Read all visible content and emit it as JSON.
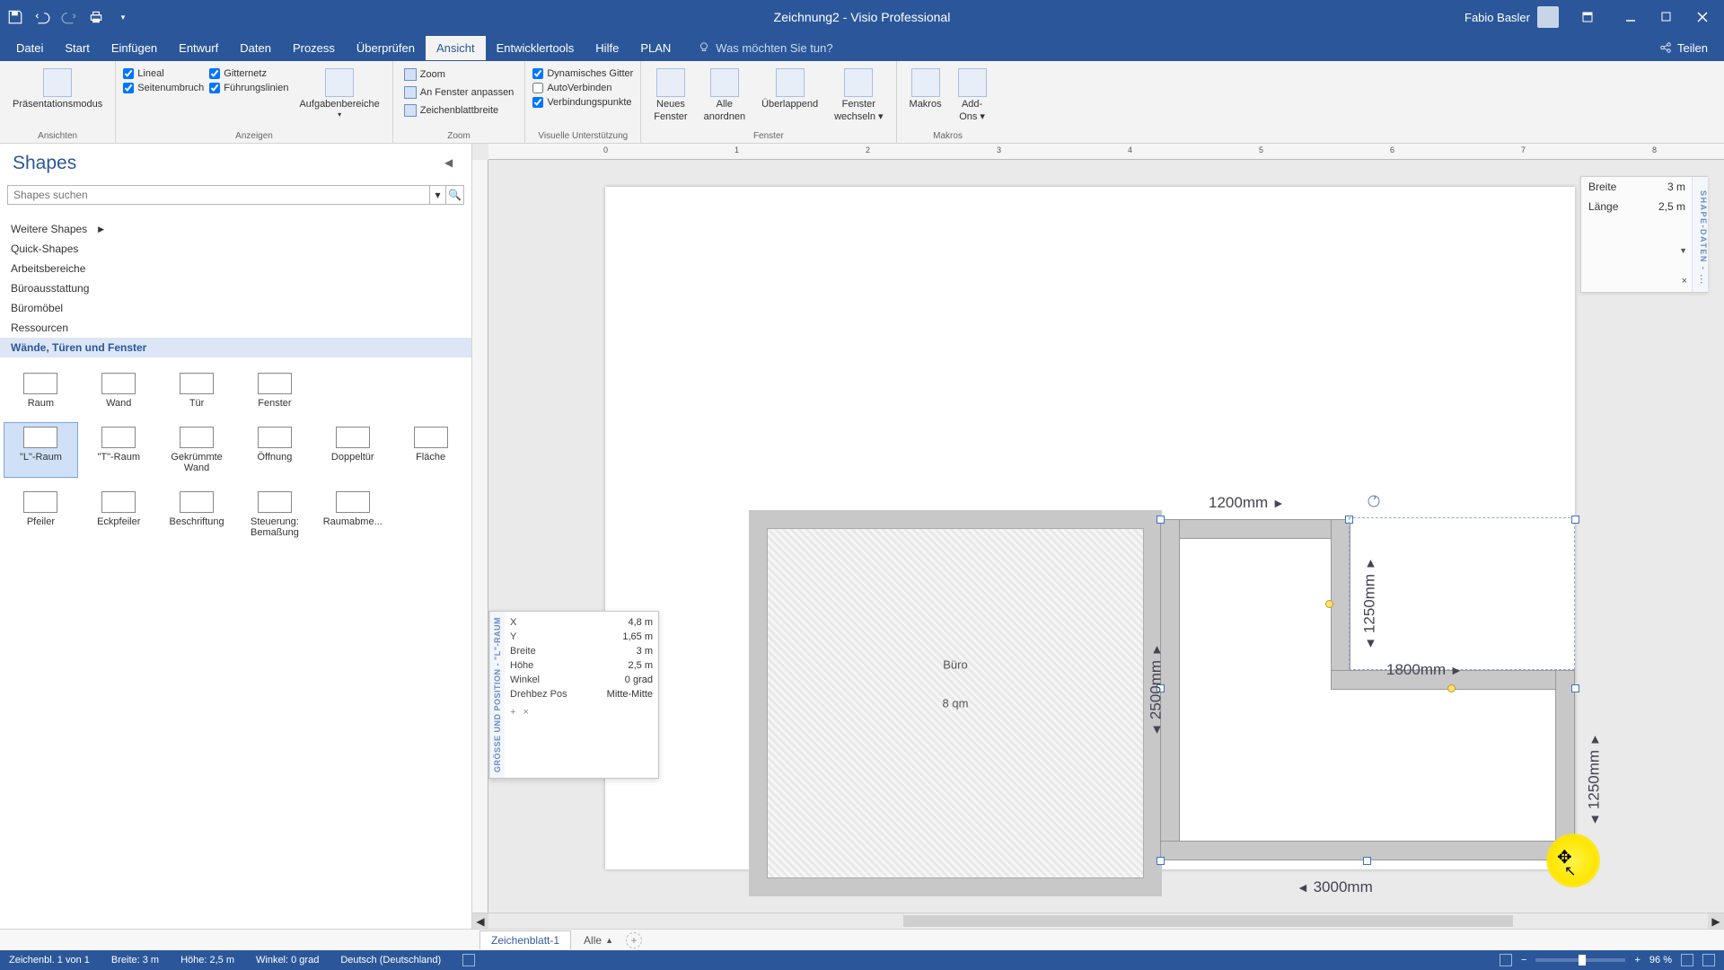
{
  "app": {
    "title": "Zeichnung2 - Visio Professional",
    "user": "Fabio Basler",
    "share": "Teilen"
  },
  "menu": {
    "items": [
      "Datei",
      "Start",
      "Einfügen",
      "Entwurf",
      "Daten",
      "Prozess",
      "Überprüfen",
      "Ansicht",
      "Entwicklertools",
      "Hilfe",
      "PLAN"
    ],
    "active": "Ansicht",
    "tell_me_placeholder": "Was möchten Sie tun?"
  },
  "ribbon": {
    "groups": {
      "ansichten": {
        "label": "Ansichten",
        "big": "Präsentationsmodus"
      },
      "anzeigen": {
        "label": "Anzeigen",
        "chk": [
          {
            "l": "Lineal",
            "c": true
          },
          {
            "l": "Seitenumbruch",
            "c": true
          },
          {
            "l": "Gitternetz",
            "c": true
          },
          {
            "l": "Führungslinien",
            "c": true
          }
        ],
        "big": "Aufgabenbereiche"
      },
      "zoom": {
        "label": "Zoom",
        "items": [
          "Zoom",
          "An Fenster anpassen",
          "Zeichenblattbreite"
        ]
      },
      "visuell": {
        "label": "Visuelle Unterstützung",
        "chk": [
          {
            "l": "Dynamisches Gitter",
            "c": true
          },
          {
            "l": "AutoVerbinden",
            "c": false
          },
          {
            "l": "Verbindungspunkte",
            "c": true
          }
        ]
      },
      "fenster": {
        "label": "Fenster",
        "btns": [
          {
            "l1": "Neues",
            "l2": "Fenster"
          },
          {
            "l1": "Alle",
            "l2": "anordnen"
          },
          {
            "l1": "Überlappend",
            "l2": ""
          },
          {
            "l1": "Fenster",
            "l2": "wechseln ▾"
          }
        ]
      },
      "makros": {
        "label": "Makros",
        "btns": [
          {
            "l1": "Makros",
            "l2": ""
          },
          {
            "l1": "Add-",
            "l2": "Ons ▾"
          }
        ]
      }
    }
  },
  "shapes": {
    "title": "Shapes",
    "search_placeholder": "Shapes suchen",
    "stencils": [
      {
        "l": "Weitere Shapes",
        "arrow": true
      },
      {
        "l": "Quick-Shapes"
      },
      {
        "l": "Arbeitsbereiche"
      },
      {
        "l": "Büroausstattung"
      },
      {
        "l": "Büromöbel"
      },
      {
        "l": "Ressourcen"
      },
      {
        "l": "Wände, Türen und Fenster",
        "sel": true
      }
    ],
    "gallery": [
      {
        "l": "Raum"
      },
      {
        "l": "Wand"
      },
      {
        "l": "Tür"
      },
      {
        "l": "Fenster"
      },
      {
        "l": ""
      },
      {
        "l": ""
      },
      {
        "l": "\"L\"-Raum",
        "sel": true
      },
      {
        "l": "\"T\"-Raum"
      },
      {
        "l": "Gekrümmte Wand"
      },
      {
        "l": "Öffnung"
      },
      {
        "l": "Doppeltür"
      },
      {
        "l": "Fläche"
      },
      {
        "l": "Pfeiler"
      },
      {
        "l": "Eckpfeiler"
      },
      {
        "l": "Beschriftung"
      },
      {
        "l": "Steuerung: Bemaßung"
      },
      {
        "l": "Raumabme..."
      },
      {
        "l": ""
      }
    ]
  },
  "canvas": {
    "ruler_ticks": [
      "0",
      "1",
      "2",
      "3",
      "4",
      "5",
      "6",
      "7",
      "8"
    ],
    "room1": {
      "name": "Büro",
      "area": "8 qm"
    },
    "dims": {
      "top": "1200mm",
      "mid_v": "2500mm",
      "r1": "1250mm",
      "mid_h": "1800mm",
      "r2": "1250mm",
      "bottom": "3000mm"
    }
  },
  "sp": {
    "title": "GRÖSSE UND POSITION - \"L\"-RAUM",
    "rows": [
      {
        "k": "X",
        "v": "4,8 m"
      },
      {
        "k": "Y",
        "v": "1,65 m"
      },
      {
        "k": "Breite",
        "v": "3 m"
      },
      {
        "k": "Höhe",
        "v": "2,5 m"
      },
      {
        "k": "Winkel",
        "v": "0 grad"
      },
      {
        "k": "Drehbez Pos",
        "v": "Mitte-Mitte"
      }
    ]
  },
  "sd": {
    "title": "SHAPE-DATEN - ...",
    "rows": [
      {
        "k": "Breite",
        "v": "3 m"
      },
      {
        "k": "Länge",
        "v": "2,5 m"
      }
    ]
  },
  "tabs": {
    "page": "Zeichenblatt-1",
    "all": "Alle"
  },
  "status": {
    "l1": "Zeichenbl. 1 von 1",
    "l2": "Breite: 3 m",
    "l3": "Höhe: 2,5 m",
    "l4": "Winkel: 0 grad",
    "l5": "Deutsch (Deutschland)",
    "zoom": "96 %"
  }
}
